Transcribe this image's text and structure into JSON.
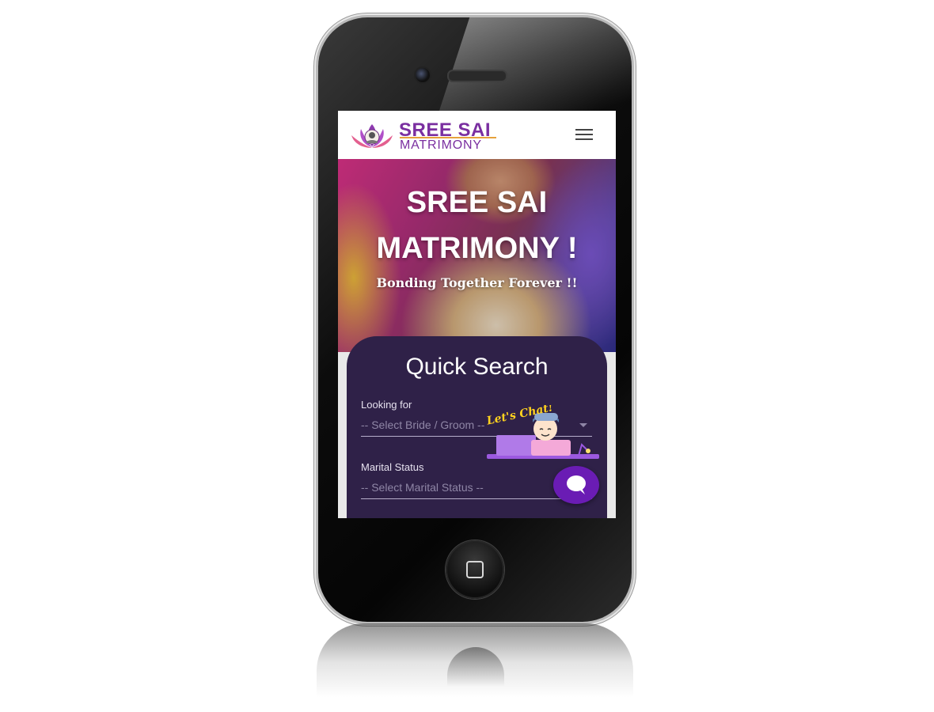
{
  "brand": {
    "name_line1": "SREE SAI",
    "name_line2": "MATRIMONY",
    "color": "#7a2fa0",
    "accent": "#e6a23c"
  },
  "navbar": {
    "menu_icon": "hamburger-menu-icon"
  },
  "hero": {
    "title": "SREE SAI MATRIMONY !",
    "subtitle": "Bonding Together Forever !!"
  },
  "quick_search": {
    "title": "Quick Search",
    "looking_for": {
      "label": "Looking for",
      "placeholder": "-- Select Bride / Groom --"
    },
    "marital_status": {
      "label": "Marital Status",
      "placeholder": "-- Select Marital Status --"
    },
    "background": "#2f2148"
  },
  "chat": {
    "badge_text": "Let's Chat!",
    "button_icon": "chat-bubble-icon",
    "button_color": "#6a1cb4"
  }
}
